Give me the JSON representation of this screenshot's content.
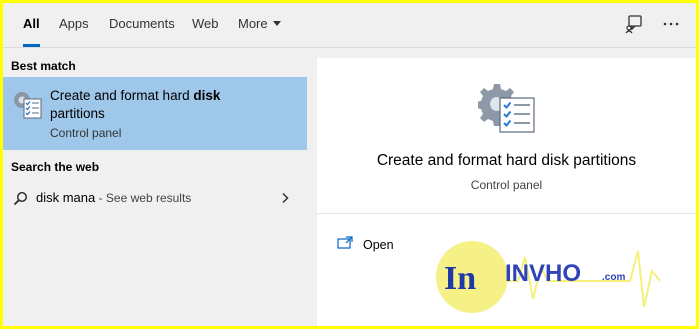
{
  "tabs": [
    {
      "label": "All",
      "active": true
    },
    {
      "label": "Apps"
    },
    {
      "label": "Documents"
    },
    {
      "label": "Web"
    },
    {
      "label": "More"
    }
  ],
  "sections": {
    "best_match": "Best match",
    "search_web": "Search the web"
  },
  "best_match": {
    "title_plain": "Create and format hard ",
    "title_bold": "disk",
    "title_rest": "partitions",
    "subtitle": "Control panel",
    "icon": "control-panel-checklist-icon"
  },
  "web_result": {
    "query": "disk mana",
    "suffix": " - See web results",
    "icon": "search-icon"
  },
  "preview": {
    "title": "Create and format hard disk partitions",
    "subtitle": "Control panel",
    "actions": [
      {
        "label": "Open",
        "icon": "open-icon"
      }
    ]
  },
  "watermark": {
    "logo": "In",
    "text": "INVHO",
    "suffix": ".com"
  },
  "colors": {
    "border": "#ffff00",
    "selected": "#9fc7ea",
    "accent": "#0067c0"
  }
}
